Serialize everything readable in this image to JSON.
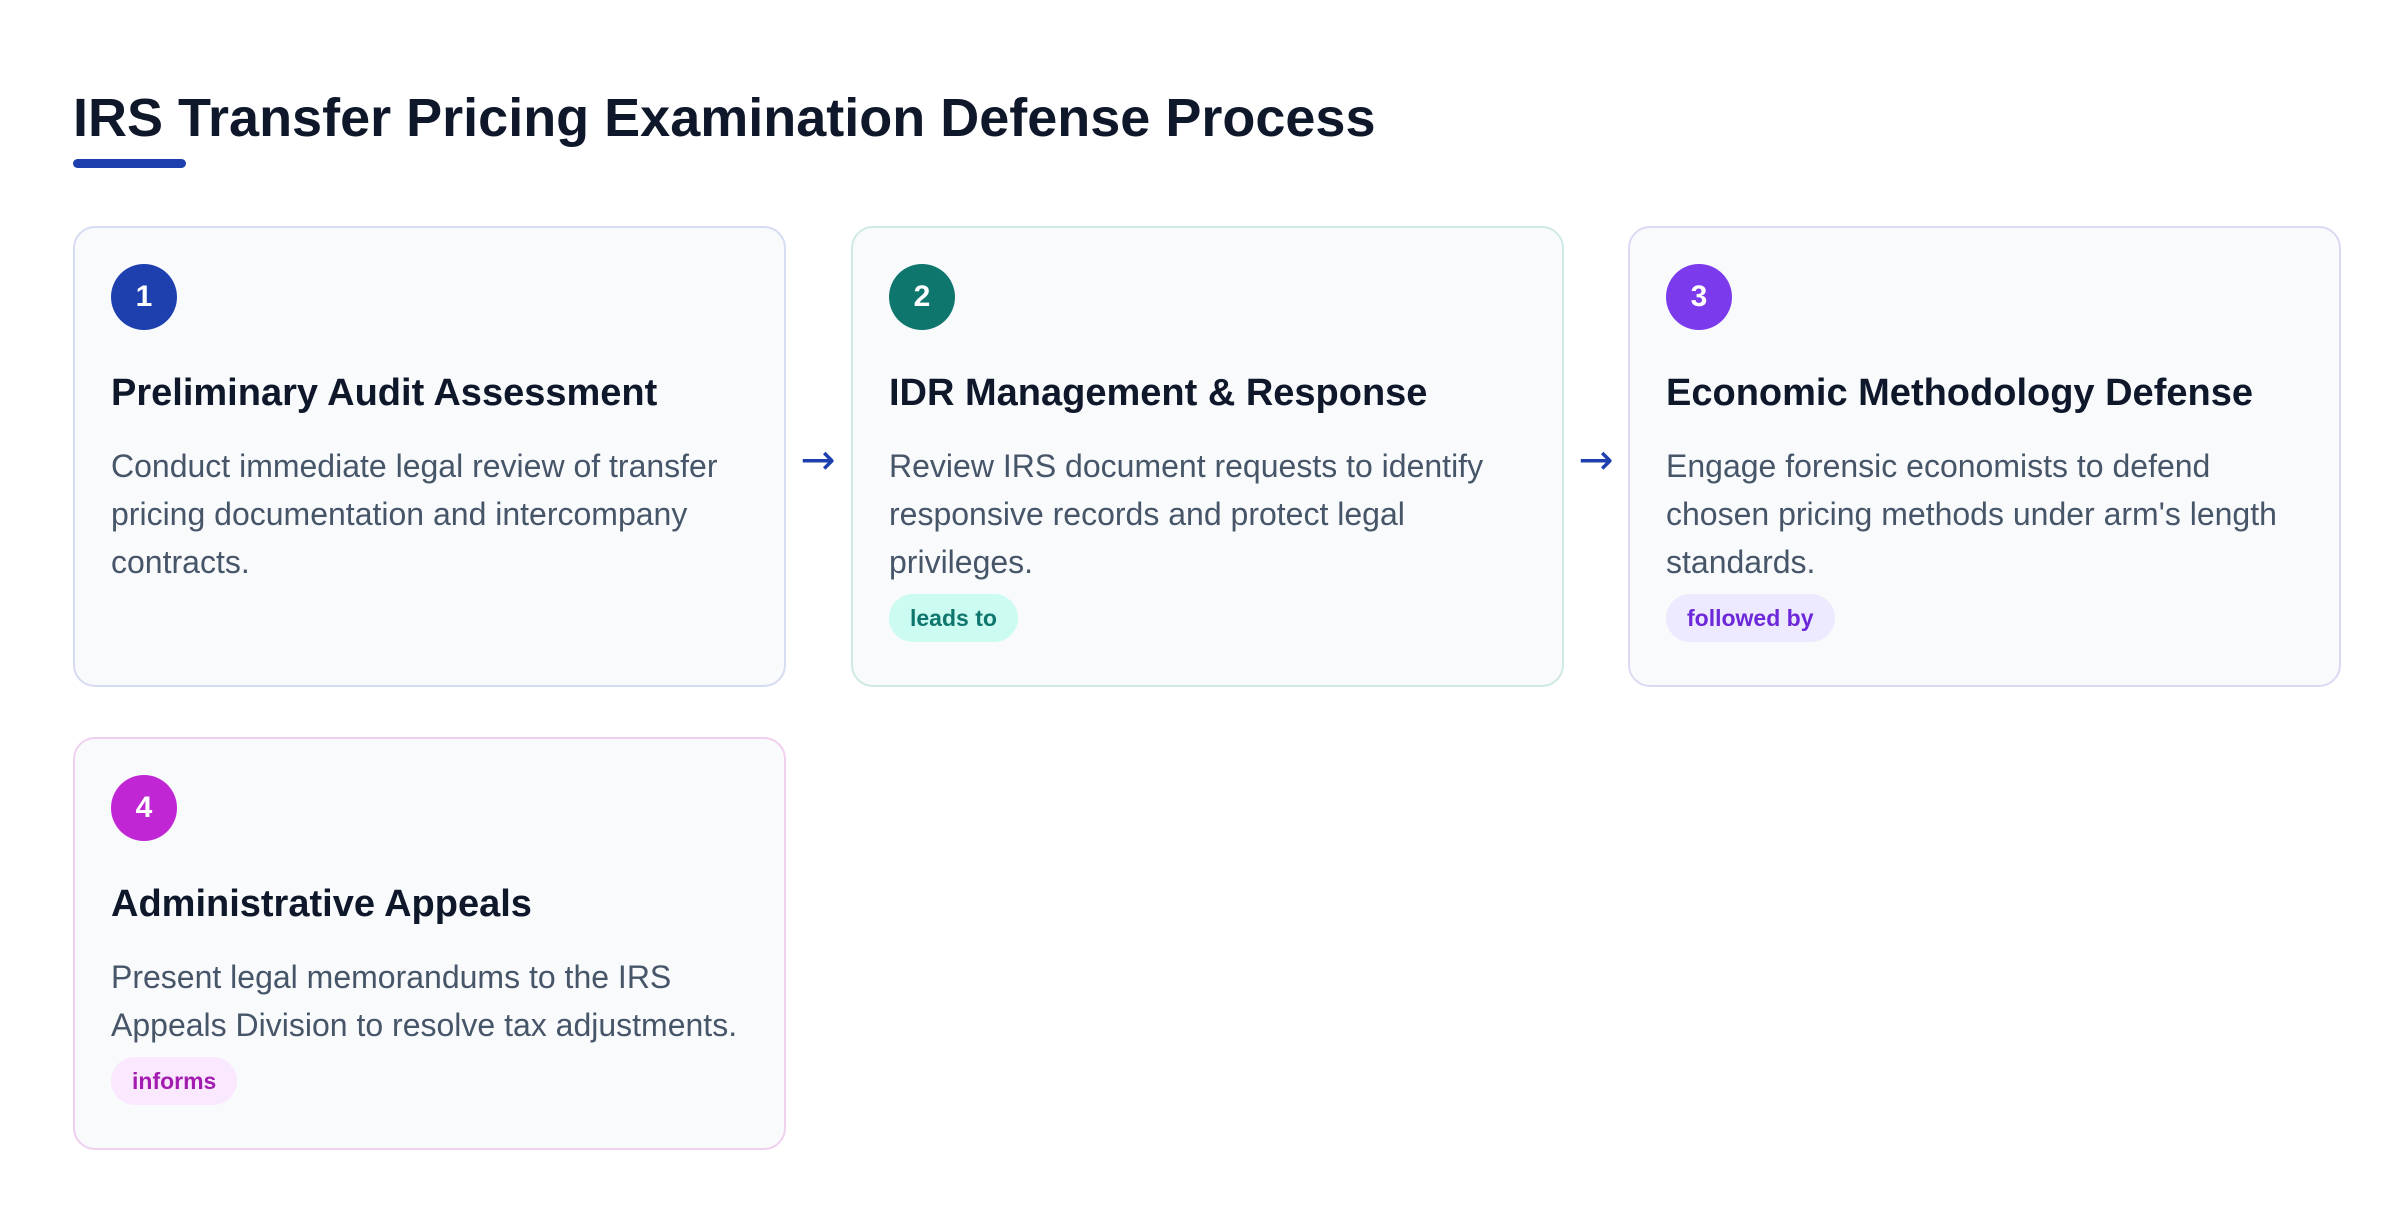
{
  "title": "IRS Transfer Pricing Examination Defense Process",
  "colors": {
    "accent": "#1e40af",
    "step1": "#1e40af",
    "step2": "#0f766e",
    "step3": "#7c3aed",
    "step4": "#c026d3"
  },
  "connector_icon": "right-arrow-icon",
  "arrows": [
    "→",
    "→"
  ],
  "steps": [
    {
      "number": "1",
      "title": "Preliminary Audit Assessment",
      "description": "Conduct immediate legal review of transfer pricing documentation and intercompany contracts.",
      "badge": ""
    },
    {
      "number": "2",
      "title": "IDR Management & Response",
      "description": "Review IRS document requests to identify responsive records and protect legal privileges.",
      "badge": "leads to"
    },
    {
      "number": "3",
      "title": "Economic Methodology Defense",
      "description": "Engage forensic economists to defend chosen pricing methods under arm's length standards.",
      "badge": "followed by"
    },
    {
      "number": "4",
      "title": "Administrative Appeals",
      "description": "Present legal memorandums to the IRS Appeals Division to resolve tax adjustments.",
      "badge": "informs"
    }
  ]
}
